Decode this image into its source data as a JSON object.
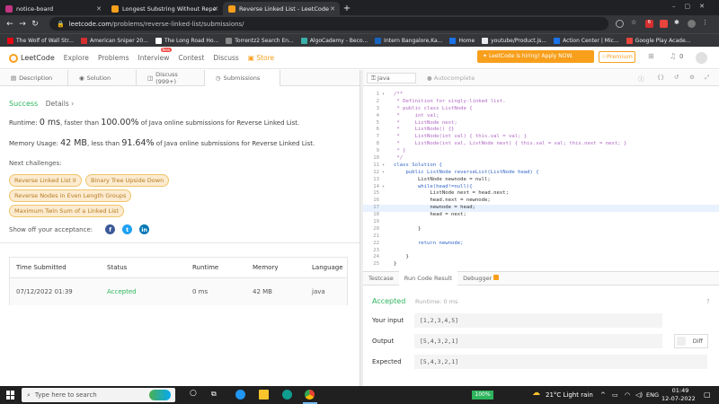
{
  "browser": {
    "tabs": [
      {
        "label": "notice-board",
        "icon": "instagram-icon",
        "color": "#c13584"
      },
      {
        "label": "Longest Substring Without Repe",
        "icon": "leetcode-icon",
        "color": "#f89f1b"
      },
      {
        "label": "Reverse Linked List - LeetCode",
        "icon": "leetcode-icon",
        "color": "#f89f1b"
      }
    ],
    "new_tab": "+",
    "url_host": "leetcode.com",
    "url_path": "/problems/reverse-linked-list/submissions/",
    "bookmarks": [
      {
        "label": "The Wolf of Wall Str...",
        "color": "#e50914"
      },
      {
        "label": "American Sniper 20...",
        "color": "#d32f2f"
      },
      {
        "label": "The Long Road Ho...",
        "color": "#ffffff"
      },
      {
        "label": "Torrentz2 Search En...",
        "color": "#888888"
      },
      {
        "label": "AlgoCademy - Beco...",
        "color": "#3ab0a8"
      },
      {
        "label": "Intern Bangalore,Ka...",
        "color": "#1565c0"
      },
      {
        "label": "Home",
        "color": "#1a73e8"
      },
      {
        "label": "youtube/Product.js...",
        "color": "#e8eaed"
      },
      {
        "label": "Action Center | Mic...",
        "color": "#1a73e8"
      },
      {
        "label": "Google Play Acade...",
        "color": "#e8453c"
      }
    ]
  },
  "lc_nav": {
    "logo": "LeetCode",
    "links": [
      "Explore",
      "Problems",
      "Interview",
      "Contest",
      "Discuss",
      "Store"
    ],
    "new_badge": "New",
    "hiring_banner": "LeetCode is hiring! Apply NOW.",
    "premium": "Premium",
    "notifications": "0"
  },
  "sub_tabs": [
    "Description",
    "Solution",
    "Discuss (999+)",
    "Submissions"
  ],
  "submission": {
    "status": "Success",
    "details": "Details",
    "runtime_label": "Runtime:",
    "runtime_value": "0 ms",
    "runtime_text1": ", faster than",
    "runtime_pct": "100.00%",
    "runtime_text2": "of Java online submissions for Reverse Linked List.",
    "memory_label": "Memory Usage:",
    "memory_value": "42 MB",
    "memory_text1": ", less than",
    "memory_pct": "91.64%",
    "memory_text2": "of Java online submissions for Reverse Linked List.",
    "next_challenges_label": "Next challenges:",
    "challenges": [
      "Reverse Linked List II",
      "Binary Tree Upside Down",
      "Reverse Nodes in Even Length Groups",
      "Maximum Twin Sum of a Linked List"
    ],
    "show_off": "Show off your acceptance:"
  },
  "table": {
    "headers": [
      "Time Submitted",
      "Status",
      "Runtime",
      "Memory",
      "Language"
    ],
    "row": [
      "07/12/2022 01:39",
      "Accepted",
      "0 ms",
      "42 MB",
      "java"
    ]
  },
  "editor": {
    "language": "Java",
    "autocomplete": "Autocomplete",
    "lines": [
      {
        "n": "1",
        "fold": "▾",
        "t": "/**",
        "c": "cm"
      },
      {
        "n": "2",
        "t": " * Definition for singly-linked list.",
        "c": "cm"
      },
      {
        "n": "3",
        "t": " * public class ListNode {",
        "c": "cm"
      },
      {
        "n": "4",
        "t": " *     int val;",
        "c": "cm"
      },
      {
        "n": "5",
        "t": " *     ListNode next;",
        "c": "cm"
      },
      {
        "n": "6",
        "t": " *     ListNode() {}",
        "c": "cm"
      },
      {
        "n": "7",
        "t": " *     ListNode(int val) { this.val = val; }",
        "c": "cm"
      },
      {
        "n": "8",
        "t": " *     ListNode(int val, ListNode next) { this.val = val; this.next = next; }",
        "c": "cm"
      },
      {
        "n": "9",
        "t": " * }",
        "c": "cm"
      },
      {
        "n": "10",
        "t": " */",
        "c": "cm"
      },
      {
        "n": "11",
        "fold": "▾",
        "t": "class Solution {",
        "c": "kw"
      },
      {
        "n": "12",
        "fold": "▾",
        "t": "    public ListNode reverseList(ListNode head) {",
        "c": "kw"
      },
      {
        "n": "13",
        "t": "        ListNode newnode = null;",
        "c": ""
      },
      {
        "n": "14",
        "fold": "▾",
        "t": "        while(head!=null){",
        "c": "kw"
      },
      {
        "n": "15",
        "t": "            ListNode next = head.next;",
        "c": ""
      },
      {
        "n": "16",
        "t": "            head.next = newnode;",
        "c": ""
      },
      {
        "n": "17",
        "t": "            newnode = head;",
        "c": "",
        "hl": true
      },
      {
        "n": "18",
        "t": "            head = next;",
        "c": ""
      },
      {
        "n": "19",
        "t": "",
        "c": ""
      },
      {
        "n": "20",
        "t": "        }",
        "c": ""
      },
      {
        "n": "21",
        "t": "",
        "c": ""
      },
      {
        "n": "22",
        "t": "        return newnode;",
        "c": "kw"
      },
      {
        "n": "23",
        "t": "",
        "c": ""
      },
      {
        "n": "24",
        "t": "    }",
        "c": ""
      },
      {
        "n": "25",
        "t": "}",
        "c": ""
      }
    ]
  },
  "console": {
    "tabs": [
      "Testcase",
      "Run Code Result",
      "Debugger"
    ],
    "accepted": "Accepted",
    "runtime": "Runtime: 0 ms",
    "input_label": "Your input",
    "input_value": "[1,2,3,4,5]",
    "output_label": "Output",
    "output_value": "[5,4,3,2,1]",
    "diff": "Diff",
    "expected_label": "Expected",
    "expected_value": "[5,4,3,2,1]"
  },
  "taskbar": {
    "search_placeholder": "Type here to search",
    "battery": "100%",
    "weather": "21°C  Light rain",
    "lang": "ENG",
    "time": "01:49",
    "date": "12-07-2022"
  }
}
